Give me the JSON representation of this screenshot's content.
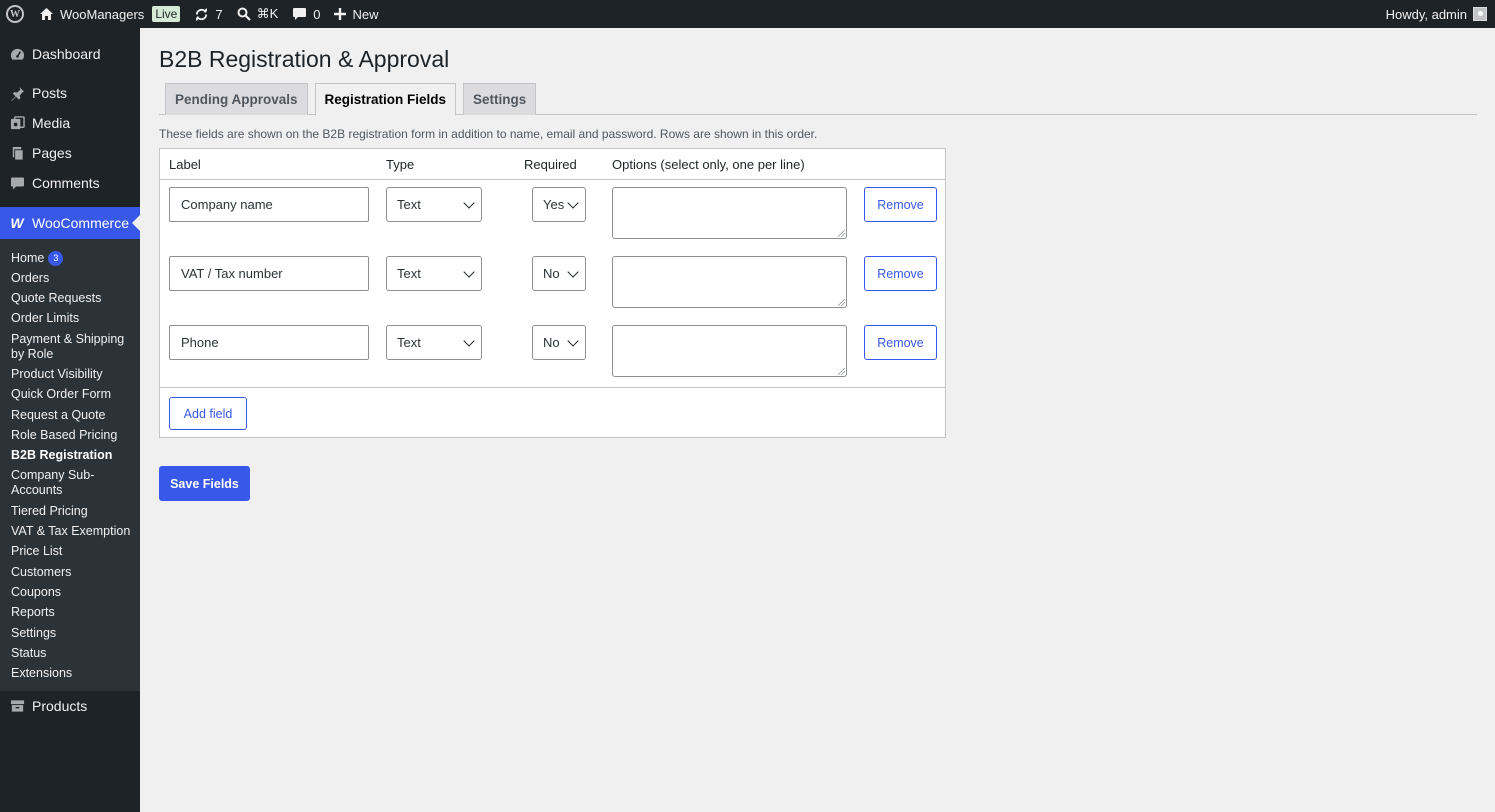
{
  "adminbar": {
    "site_name": "WooManagers",
    "live_badge": "Live",
    "updates_count": "7",
    "search_shortcut": "⌘K",
    "comments_count": "0",
    "new_label": "New",
    "greeting": "Howdy, admin"
  },
  "sidebar": {
    "dashboard": "Dashboard",
    "posts": "Posts",
    "media": "Media",
    "pages": "Pages",
    "comments": "Comments",
    "woocommerce": "WooCommerce",
    "home": "Home",
    "home_badge": "3",
    "submenu": [
      "Orders",
      "Quote Requests",
      "Order Limits",
      "Payment & Shipping by Role",
      "Product Visibility",
      "Quick Order Form",
      "Request a Quote",
      "Role Based Pricing",
      "B2B Registration",
      "Company Sub-Accounts",
      "Tiered Pricing",
      "VAT & Tax Exemption",
      "Price List",
      "Customers",
      "Coupons",
      "Reports",
      "Settings",
      "Status",
      "Extensions"
    ],
    "products": "Products"
  },
  "main": {
    "title": "B2B Registration & Approval",
    "tabs": [
      {
        "label": "Pending Approvals"
      },
      {
        "label": "Registration Fields"
      },
      {
        "label": "Settings"
      }
    ],
    "description": "These fields are shown on the B2B registration form in addition to name, email and password. Rows are shown in this order.",
    "columns": {
      "label": "Label",
      "type": "Type",
      "required": "Required",
      "options": "Options (select only, one per line)"
    },
    "rows": [
      {
        "label": "Company name",
        "type": "Text",
        "required": "Yes",
        "options": "",
        "remove": "Remove"
      },
      {
        "label": "VAT / Tax number",
        "type": "Text",
        "required": "No",
        "options": "",
        "remove": "Remove"
      },
      {
        "label": "Phone",
        "type": "Text",
        "required": "No",
        "options": "",
        "remove": "Remove"
      }
    ],
    "add_field": "Add field",
    "save_fields": "Save Fields"
  },
  "colors": {
    "accent": "#3858e9",
    "adminbar_bg": "#1d2327",
    "body_bg": "#f0f0f1"
  }
}
